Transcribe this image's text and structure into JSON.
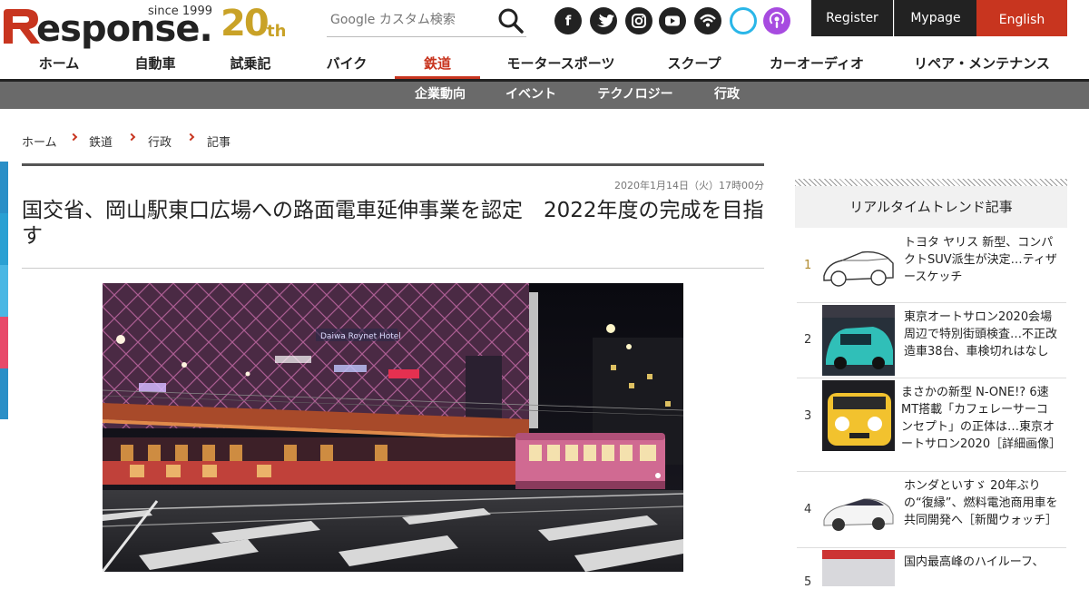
{
  "header": {
    "logo_since": "since 1999",
    "logo_word": "esponse.",
    "logo_anniversary": "20",
    "logo_anniversary_suffix": "th",
    "search_placeholder": "Google カスタム検索",
    "social_icons": [
      "facebook-icon",
      "twitter-icon",
      "instagram-icon",
      "youtube-icon",
      "wifi-feed-icon",
      "alexa-icon",
      "podcast-icon"
    ],
    "register_label": "Register",
    "mypage_label": "Mypage",
    "english_label": "English"
  },
  "nav": {
    "items": [
      "ホーム",
      "自動車",
      "試乗記",
      "バイク",
      "鉄道",
      "モータースポーツ",
      "スクープ",
      "カーオーディオ",
      "リペア・メンテナンス"
    ],
    "active": "鉄道",
    "sub_items": [
      "企業動向",
      "イベント",
      "テクノロジー",
      "行政"
    ]
  },
  "breadcrumb": [
    "ホーム",
    "鉄道",
    "行政",
    "記事"
  ],
  "article": {
    "date": "2020年1月14日（火）17時00分",
    "title": "国交省、岡山駅東口広場への路面電車延伸事業を認定　2022年度の完成を目指す",
    "photo_sign_text": "Daiwa Roynet Hotel"
  },
  "sidebar": {
    "heading": "リアルタイムトレンド記事",
    "items": [
      {
        "rank": "1",
        "text": "トヨタ ヤリス 新型、コンパクトSUV派生が決定…ティザースケッチ"
      },
      {
        "rank": "2",
        "text": "東京オートサロン2020会場周辺で特別街頭検査…不正改造車38台、車検切れはなし"
      },
      {
        "rank": "3",
        "text": "まさかの新型 N-ONE!? 6速MT搭載「カフェレーサーコンセプト」の正体は…東京オートサロン2020［詳細画像］"
      },
      {
        "rank": "4",
        "text": "ホンダといすゞ 20年ぶりの“復縁”、燃料電池商用車を共同開発へ［新聞ウォッチ］"
      },
      {
        "rank": "5",
        "text": "国内最高峰のハイルーフ、"
      }
    ]
  },
  "colors": {
    "accent_red": "#c8351f",
    "logo_gold": "#c9a227",
    "subnav_gray": "#6a6a6a",
    "side_strip": [
      "#2a8fc7",
      "#2aa0d3",
      "#4ab7e4",
      "#e84a6a",
      "#2a8fc7"
    ]
  }
}
